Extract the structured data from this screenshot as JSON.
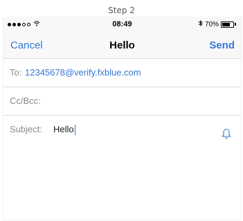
{
  "caption": "Step 2",
  "status_bar": {
    "time": "08:49",
    "battery_percent": "70%",
    "battery_level": 0.7,
    "icons": [
      "signal-icon",
      "wifi-icon",
      "bluetooth-icon",
      "battery-icon"
    ]
  },
  "navbar": {
    "cancel_label": "Cancel",
    "title": "Hello",
    "send_label": "Send"
  },
  "fields": {
    "to_label": "To:",
    "to_value": "12345678@verify.fxblue.com",
    "cc_label": "Cc/Bcc:",
    "subject_label": "Subject:",
    "subject_value": "Hello"
  },
  "colors": {
    "accent": "#3478d7",
    "label": "#8a8a8a",
    "separator": "#dddddd"
  }
}
